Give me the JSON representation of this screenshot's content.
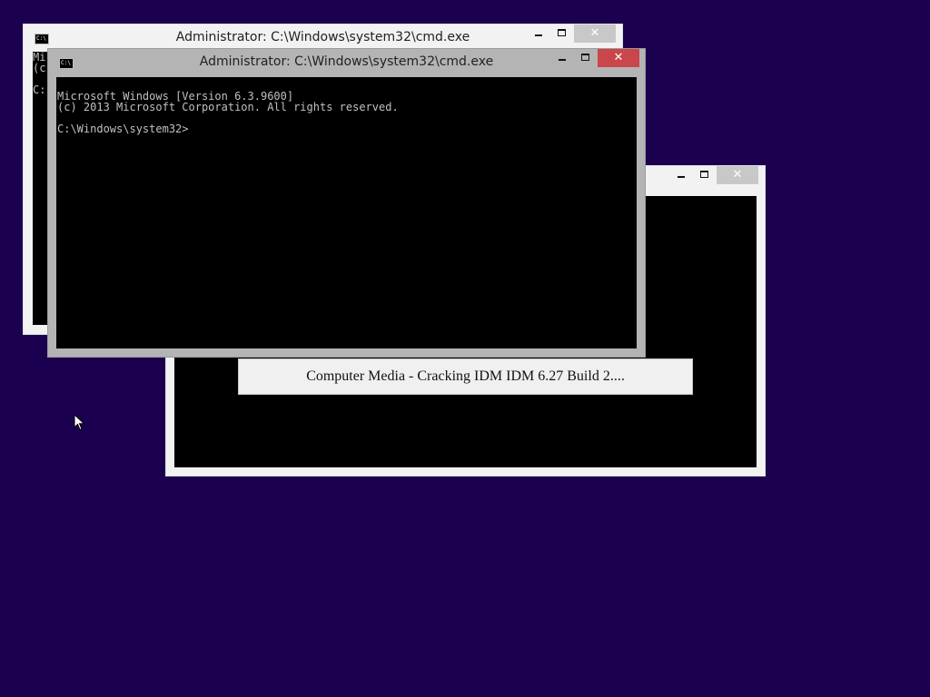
{
  "desktop": {
    "background_color": "#1c0050"
  },
  "back_cmd_window": {
    "title": "Administrator: C:\\Windows\\system32\\cmd.exe",
    "icon_text": "C:\\",
    "console_text": "Mi\n(c\n\nC:",
    "controls": {
      "minimize_icon": "minimize-icon",
      "maximize_icon": "maximize-icon",
      "close_icon": "✕"
    }
  },
  "third_window": {
    "controls": {
      "minimize_icon": "minimize-icon",
      "maximize_icon": "maximize-icon",
      "close_icon": "✕"
    }
  },
  "front_cmd_window": {
    "title": "Administrator: C:\\Windows\\system32\\cmd.exe",
    "icon_text": "C:\\",
    "console_lines": [
      "Microsoft Windows [Version 6.3.9600]",
      "(c) 2013 Microsoft Corporation. All rights reserved.",
      "",
      "C:\\Windows\\system32>"
    ],
    "controls": {
      "minimize_icon": "minimize-icon",
      "maximize_icon": "maximize-icon",
      "close_icon": "✕",
      "close_color": "#c9464a"
    }
  },
  "caption": {
    "text": "Computer Media - Cracking IDM IDM 6.27 Build 2...."
  },
  "cursor": {
    "icon": "mouse-pointer-icon"
  }
}
